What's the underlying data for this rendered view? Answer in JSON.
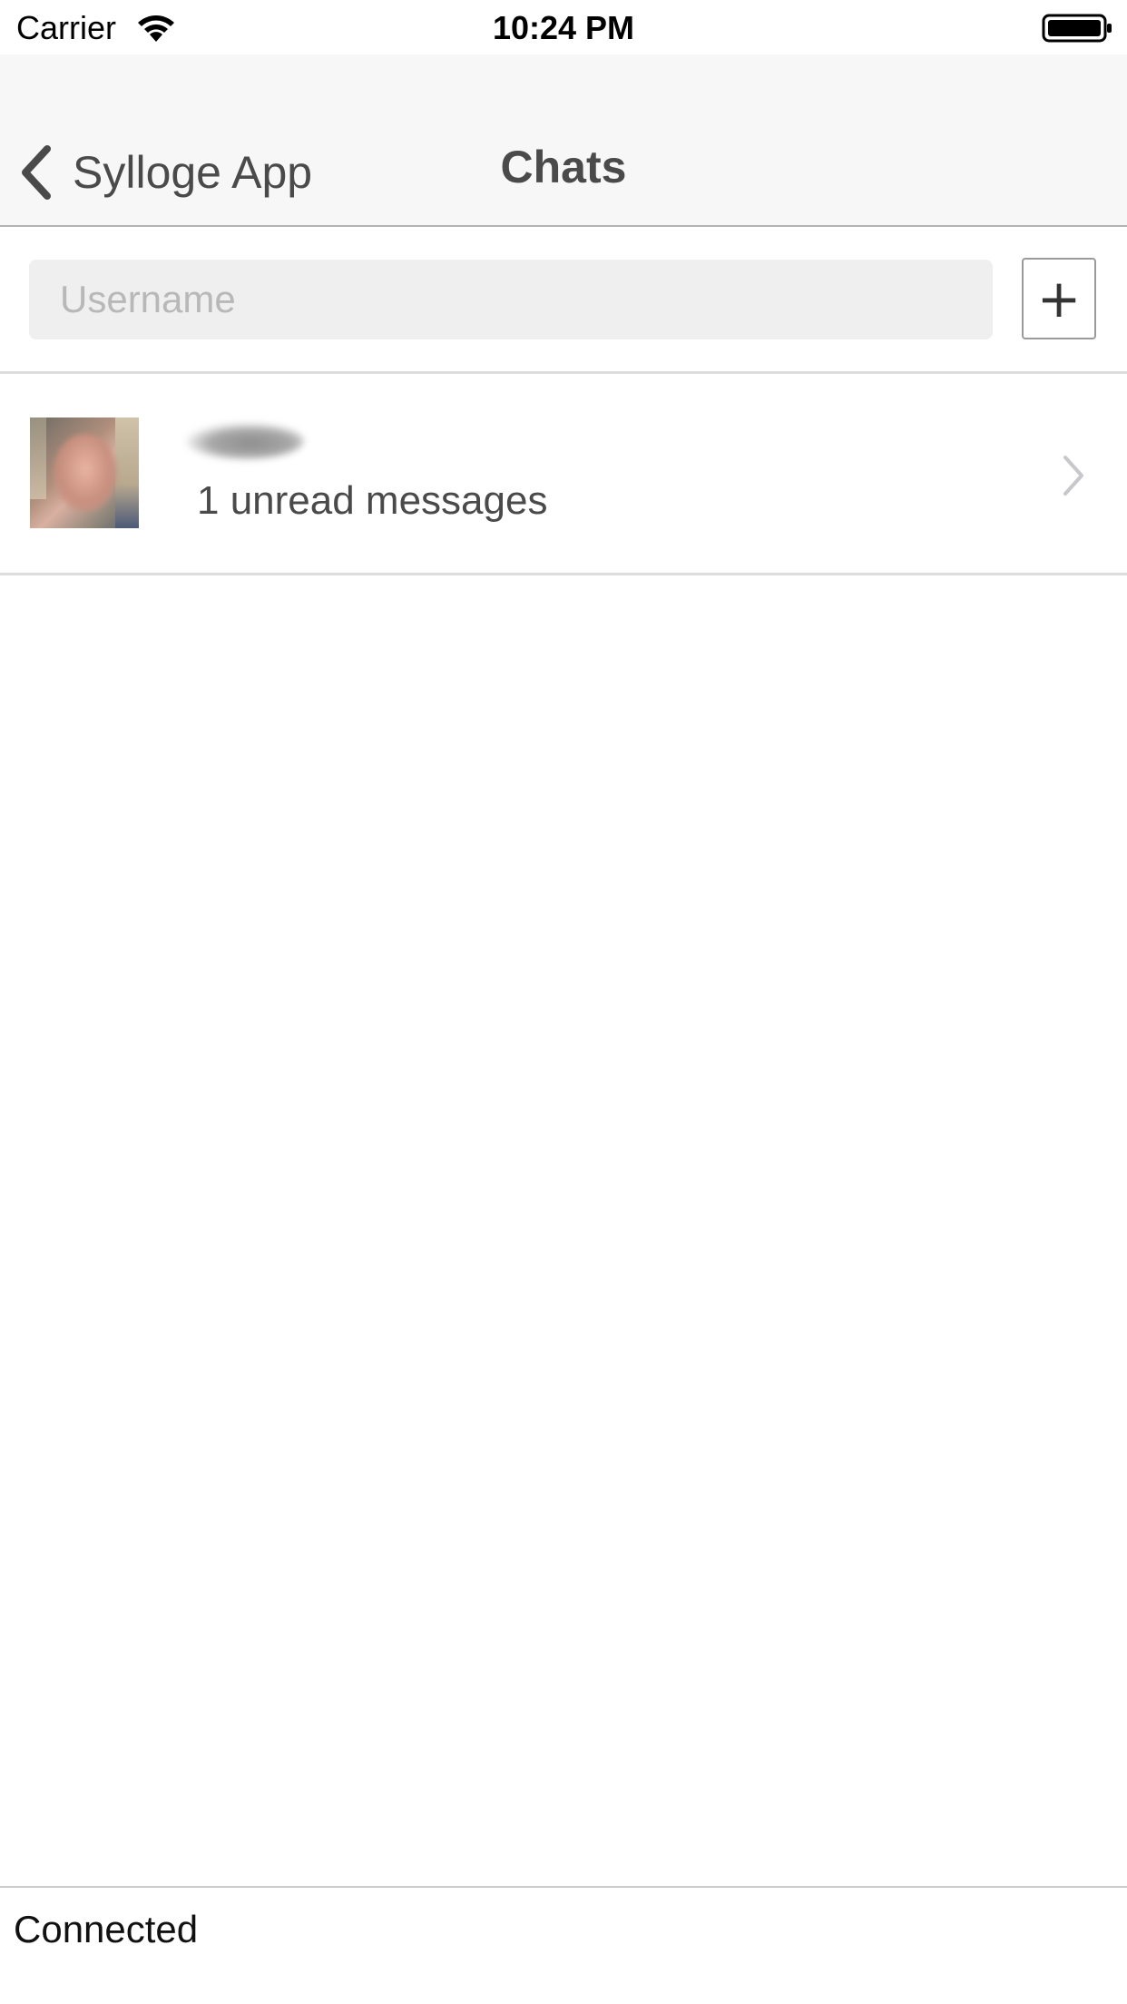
{
  "status_bar": {
    "carrier": "Carrier",
    "time": "10:24 PM",
    "wifi_icon": "wifi-icon",
    "battery_icon": "battery-icon"
  },
  "nav": {
    "back_label": "Sylloge App",
    "back_icon": "chevron-left-icon",
    "title": "Chats"
  },
  "search": {
    "placeholder": "Username",
    "value": "",
    "add_icon": "plus-icon",
    "add_label": "+"
  },
  "chats": [
    {
      "avatar_icon": "avatar",
      "name": "",
      "subtitle": "1 unread messages",
      "chevron_icon": "chevron-right-icon"
    }
  ],
  "footer": {
    "connection_status": "Connected"
  },
  "colors": {
    "nav_background": "#f7f7f7",
    "input_background": "#efefef",
    "text_primary": "#4a4a4a",
    "separator": "#dddddd"
  }
}
